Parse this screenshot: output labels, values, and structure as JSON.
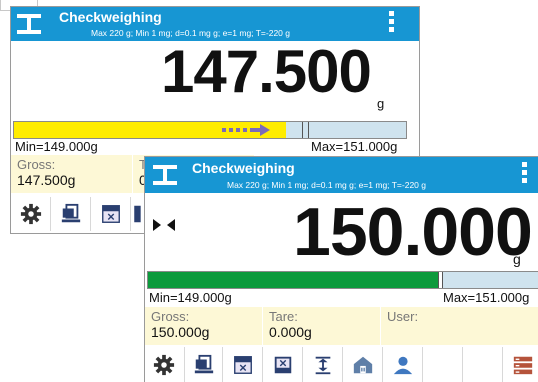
{
  "screen_back": {
    "title": "Checkweighing",
    "subtitle": "Max 220 g; Min 1 mg; d=0.1 mg g; e=1 mg; T=-220 g",
    "reading": "147.500",
    "unit": "g",
    "bargraph_level": 0.69,
    "min_label": "Min=149.000g",
    "max_label": "Max=151.000g",
    "gross_label": "Gross:",
    "gross_value": "147.500g",
    "tare_label_partial": "T",
    "tare_value_partial": "0"
  },
  "screen_front": {
    "title": "Checkweighing",
    "subtitle": "Max 220 g; Min 1 mg; d=0.1 mg g; e=1 mg; T=-220 g",
    "reading": "150.000",
    "unit": "g",
    "bargraph_level": 0.74,
    "min_label": "Min=149.000g",
    "max_label": "Max=151.000g",
    "gross_label": "Gross:",
    "gross_value": "150.000g",
    "tare_label": "Tare:",
    "tare_value": "0.000g",
    "user_label": "User:",
    "user_value": ""
  },
  "colors": {
    "header": "#1796d3",
    "bargraph_under": "#ffec00",
    "bargraph_ok": "#0c9a3c",
    "info_panel": "#fdf8d6",
    "arrow": "#7b6bb8"
  },
  "toolbar_icons": [
    "gear-icon",
    "tare-icon",
    "min-limit-icon",
    "max-limit-icon",
    "zero-icon",
    "home-icon",
    "user-icon",
    "database-icon"
  ]
}
